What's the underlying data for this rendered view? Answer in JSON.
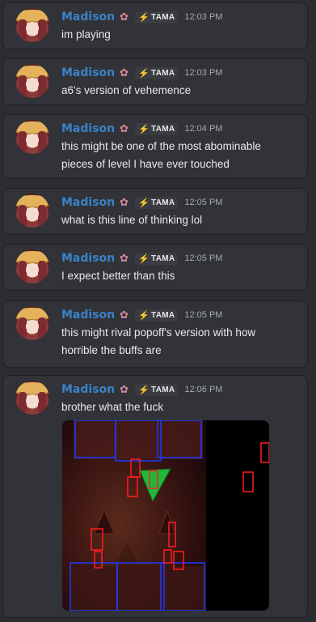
{
  "messages": [
    {
      "username": "Madison",
      "tag": "TAMA",
      "time": "12:03 PM",
      "lines": [
        "im playing"
      ]
    },
    {
      "username": "Madison",
      "tag": "TAMA",
      "time": "12:03 PM",
      "lines": [
        "a6's version of vehemence"
      ]
    },
    {
      "username": "Madison",
      "tag": "TAMA",
      "time": "12:04 PM",
      "lines": [
        "this might be one of the most abominable",
        "pieces of level I have ever touched"
      ]
    },
    {
      "username": "Madison",
      "tag": "TAMA",
      "time": "12:05 PM",
      "lines": [
        "what is this line of thinking lol"
      ]
    },
    {
      "username": "Madison",
      "tag": "TAMA",
      "time": "12:05 PM",
      "lines": [
        "I expect better than this"
      ]
    },
    {
      "username": "Madison",
      "tag": "TAMA",
      "time": "12:05 PM",
      "lines": [
        "this might rival popoff's version with how",
        "horrible the buffs are"
      ]
    },
    {
      "username": "Madison",
      "tag": "TAMA",
      "time": "12:06 PM",
      "lines": [
        "brother what the fuck"
      ]
    }
  ],
  "colors": {
    "background": "#2b2d31",
    "message_background": "#313338",
    "username": "#3b82c8",
    "text": "#e8e9ec",
    "time": "#a6a9b1",
    "hitbox_blue": "#1d3bff",
    "hitbox_red": "#ff1e1e",
    "player_green": "#1fb73c"
  }
}
